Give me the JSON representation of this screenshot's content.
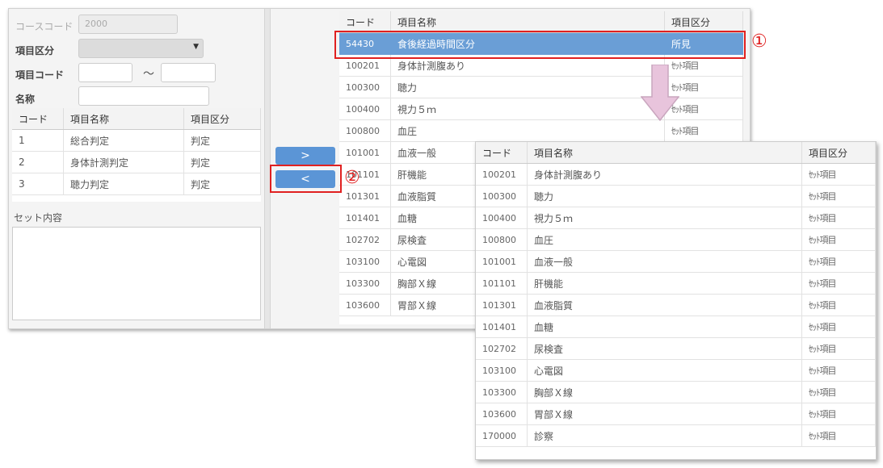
{
  "form": {
    "course_code_label": "コースコード",
    "course_code_value": "2000",
    "item_type_label": "項目区分",
    "item_code_label": "項目コード",
    "range_sep": "～",
    "name_label": "名称"
  },
  "left_table": {
    "headers": [
      "コード",
      "項目名称",
      "項目区分"
    ],
    "rows": [
      {
        "code": "1",
        "name": "総合判定",
        "kind": "判定"
      },
      {
        "code": "2",
        "name": "身体計測判定",
        "kind": "判定"
      },
      {
        "code": "3",
        "name": "聴力判定",
        "kind": "判定"
      }
    ]
  },
  "set_contents_label": "セット内容",
  "buttons": {
    "add": ">",
    "remove": "<"
  },
  "right_table": {
    "headers": [
      "コード",
      "項目名称",
      "項目区分"
    ],
    "rows": [
      {
        "code": "54430",
        "name": "食後経過時間区分",
        "kind": "所見"
      },
      {
        "code": "100201",
        "name": "身体計測腹あり",
        "kind": "ｾｯﾄ項目"
      },
      {
        "code": "100300",
        "name": "聴力",
        "kind": "ｾｯﾄ項目"
      },
      {
        "code": "100400",
        "name": "視力５ｍ",
        "kind": "ｾｯﾄ項目"
      },
      {
        "code": "100800",
        "name": "血圧",
        "kind": "ｾｯﾄ項目"
      },
      {
        "code": "101001",
        "name": "血液一般",
        "kind": ""
      },
      {
        "code": "101101",
        "name": "肝機能",
        "kind": ""
      },
      {
        "code": "101301",
        "name": "血液脂質",
        "kind": ""
      },
      {
        "code": "101401",
        "name": "血糖",
        "kind": ""
      },
      {
        "code": "102702",
        "name": "尿検査",
        "kind": ""
      },
      {
        "code": "103100",
        "name": "心電図",
        "kind": ""
      },
      {
        "code": "103300",
        "name": "胸部Ｘ線",
        "kind": ""
      },
      {
        "code": "103600",
        "name": "胃部Ｘ線",
        "kind": ""
      }
    ]
  },
  "result_table": {
    "headers": [
      "コード",
      "項目名称",
      "項目区分"
    ],
    "rows": [
      {
        "code": "100201",
        "name": "身体計測腹あり",
        "kind": "ｾｯﾄ項目"
      },
      {
        "code": "100300",
        "name": "聴力",
        "kind": "ｾｯﾄ項目"
      },
      {
        "code": "100400",
        "name": "視力５ｍ",
        "kind": "ｾｯﾄ項目"
      },
      {
        "code": "100800",
        "name": "血圧",
        "kind": "ｾｯﾄ項目"
      },
      {
        "code": "101001",
        "name": "血液一般",
        "kind": "ｾｯﾄ項目"
      },
      {
        "code": "101101",
        "name": "肝機能",
        "kind": "ｾｯﾄ項目"
      },
      {
        "code": "101301",
        "name": "血液脂質",
        "kind": "ｾｯﾄ項目"
      },
      {
        "code": "101401",
        "name": "血糖",
        "kind": "ｾｯﾄ項目"
      },
      {
        "code": "102702",
        "name": "尿検査",
        "kind": "ｾｯﾄ項目"
      },
      {
        "code": "103100",
        "name": "心電図",
        "kind": "ｾｯﾄ項目"
      },
      {
        "code": "103300",
        "name": "胸部Ｘ線",
        "kind": "ｾｯﾄ項目"
      },
      {
        "code": "103600",
        "name": "胃部Ｘ線",
        "kind": "ｾｯﾄ項目"
      },
      {
        "code": "170000",
        "name": "診察",
        "kind": "ｾｯﾄ項目"
      }
    ]
  },
  "annotations": {
    "marker1": "①",
    "marker2": "②"
  },
  "colors": {
    "selection": "#6a9ed6",
    "button": "#5b95d6",
    "annotation": "#e02020",
    "arrow": "#e8c4dc"
  },
  "icons": {
    "down_arrow": "down-arrow-icon",
    "dropdown": "chevron-down-icon"
  }
}
